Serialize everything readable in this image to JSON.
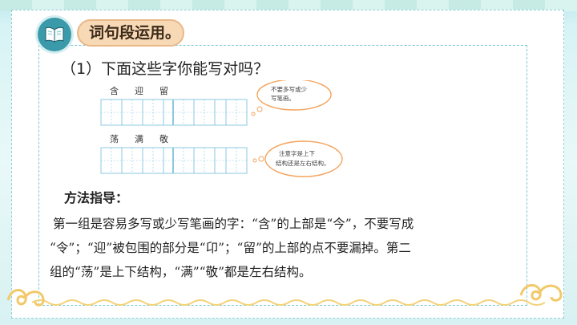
{
  "header": {
    "title": "词句段运用。",
    "icon": "book-icon"
  },
  "question": "（1）下面这些字你能写对吗？",
  "exercise": {
    "row1": {
      "characters": [
        "含",
        "迎",
        "留"
      ]
    },
    "row2": {
      "characters": [
        "荡",
        "满",
        "敬"
      ]
    },
    "bubble1": [
      "不要多写或少",
      "写笔画。"
    ],
    "bubble2": [
      "注意字是上下",
      "结构还是左右结构。"
    ]
  },
  "method": {
    "title": "方法指导：",
    "lines": [
      "第一组是容易多写或少写笔画的字：“含”的上部是“今”，不要写成",
      "“令”；“迎”被包围的部分是“卬”；“留”的上部的点不要漏掉。第二",
      "组的“荡”是上下结构，“满”“敬”都是左右结构。"
    ]
  },
  "colors": {
    "accent": "#3a9aa9",
    "pill": "#f8d9b6",
    "grid": "#8cc9e0",
    "bubble": "#f3a35c"
  }
}
